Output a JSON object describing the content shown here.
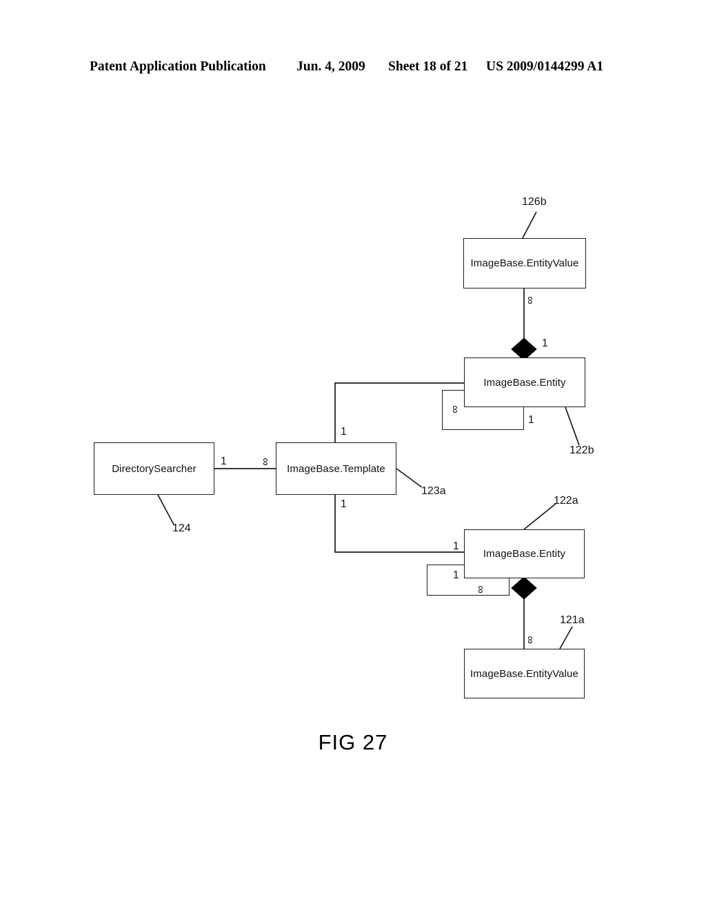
{
  "header": {
    "publication": "Patent Application Publication",
    "date": "Jun. 4, 2009",
    "sheet": "Sheet 18 of 21",
    "patent_number": "US 2009/0144299 A1"
  },
  "figure": {
    "caption": "FIG 27",
    "type": "uml-class-diagram"
  },
  "diagram": {
    "boxes": [
      {
        "id": "entityvalue_top",
        "label": "ImageBase.EntityValue",
        "ref": "126b"
      },
      {
        "id": "entity_top",
        "label": "ImageBase.Entity",
        "ref": "122b"
      },
      {
        "id": "directory_searcher",
        "label": "DirectorySearcher",
        "ref": "124"
      },
      {
        "id": "template",
        "label": "ImageBase.Template",
        "ref": "123a"
      },
      {
        "id": "entity_bottom",
        "label": "ImageBase.Entity",
        "ref": "122a"
      },
      {
        "id": "entityvalue_bottom",
        "label": "ImageBase.EntityValue",
        "ref": "121a"
      }
    ],
    "reference_numerals": [
      {
        "id": "ref_126b",
        "text": "126b"
      },
      {
        "id": "ref_122b",
        "text": "122b"
      },
      {
        "id": "ref_124",
        "text": "124"
      },
      {
        "id": "ref_123a",
        "text": "123a"
      },
      {
        "id": "ref_122a",
        "text": "122a"
      },
      {
        "id": "ref_121a",
        "text": "121a"
      }
    ],
    "multiplicities": [
      {
        "id": "m_ev_top_to_entity_top",
        "text": "∞"
      },
      {
        "id": "m_entity_top_composite",
        "text": "1"
      },
      {
        "id": "m_entity_top_self_many",
        "text": "∞"
      },
      {
        "id": "m_entity_top_self_one",
        "text": "1"
      },
      {
        "id": "m_template_to_entity_top",
        "text": "1"
      },
      {
        "id": "m_searcher_one",
        "text": "1"
      },
      {
        "id": "m_template_many",
        "text": "∞"
      },
      {
        "id": "m_template_to_entity_bottom",
        "text": "1"
      },
      {
        "id": "m_entity_bottom_in",
        "text": "1"
      },
      {
        "id": "m_entity_bottom_self_one",
        "text": "1"
      },
      {
        "id": "m_entity_bottom_self_many",
        "text": "∞"
      },
      {
        "id": "m_entity_bottom_to_ev",
        "text": "∞"
      }
    ],
    "composition_diamonds": [
      {
        "id": "diamond_top",
        "name": "composition-diamond"
      },
      {
        "id": "diamond_bottom",
        "name": "composition-diamond"
      }
    ]
  },
  "colors": {
    "ink": "#111111",
    "line": "#1a1a1a",
    "paper": "#ffffff"
  }
}
